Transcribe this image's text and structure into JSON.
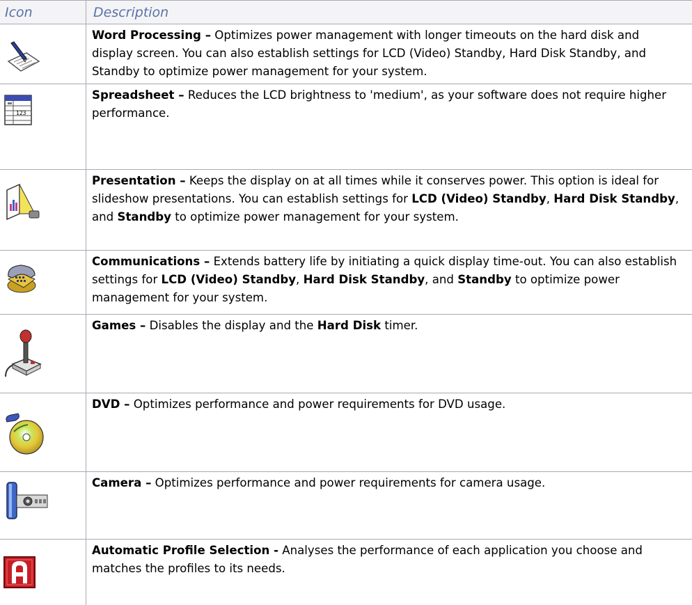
{
  "table": {
    "headers": {
      "icon": "Icon",
      "description": "Description"
    },
    "rows": [
      {
        "icon": "word-processing-icon",
        "title": "Word Processing –",
        "segments": [
          {
            "t": " Optimizes power management with longer timeouts on the hard disk and display screen. You can also establish settings for LCD (Video) Standby, Hard Disk Standby, and Standby to optimize power management for your system.",
            "b": false
          }
        ]
      },
      {
        "icon": "spreadsheet-icon",
        "title": "Spreadsheet –",
        "segments": [
          {
            "t": " Reduces the LCD brightness to 'medium', as your software does not require higher performance.",
            "b": false
          }
        ]
      },
      {
        "icon": "presentation-icon",
        "title": "Presentation –",
        "segments": [
          {
            "t": " Keeps the display on at all times while it conserves power. This option is ideal for slideshow presentations. You can establish settings for ",
            "b": false
          },
          {
            "t": "LCD (Video) Standby",
            "b": true
          },
          {
            "t": ", ",
            "b": false
          },
          {
            "t": "Hard Disk Standby",
            "b": true
          },
          {
            "t": ", and ",
            "b": false
          },
          {
            "t": "Standby",
            "b": true
          },
          {
            "t": " to optimize power management for your system.",
            "b": false
          }
        ]
      },
      {
        "icon": "communications-icon",
        "title": "Communications –",
        "segments": [
          {
            "t": " Extends battery life by initiating a quick display time-out. You can also establish settings for ",
            "b": false
          },
          {
            "t": "LCD (Video) Standby",
            "b": true
          },
          {
            "t": ", ",
            "b": false
          },
          {
            "t": "Hard Disk Standby",
            "b": true
          },
          {
            "t": ", and ",
            "b": false
          },
          {
            "t": "Standby",
            "b": true
          },
          {
            "t": " to optimize power management for your system.",
            "b": false
          }
        ]
      },
      {
        "icon": "games-joystick-icon",
        "title": "Games –",
        "segments": [
          {
            "t": " Disables the display and the ",
            "b": false
          },
          {
            "t": "Hard Disk",
            "b": true
          },
          {
            "t": " timer.",
            "b": false
          }
        ]
      },
      {
        "icon": "dvd-icon",
        "title": "DVD –",
        "segments": [
          {
            "t": " Optimizes performance and power requirements for DVD usage.",
            "b": false
          }
        ]
      },
      {
        "icon": "camera-icon",
        "title": "Camera –",
        "segments": [
          {
            "t": " Optimizes performance and power requirements for camera usage.",
            "b": false
          }
        ]
      },
      {
        "icon": "automatic-profile-icon",
        "title": "Automatic Profile Selection -",
        "segments": [
          {
            "t": " Analyses the performance of each application you choose and matches the profiles to its needs.",
            "b": false
          }
        ]
      }
    ]
  },
  "colors": {
    "header_text": "#5a72a8",
    "header_bg": "#f4f4f6",
    "rule": "#a9a9b3"
  }
}
